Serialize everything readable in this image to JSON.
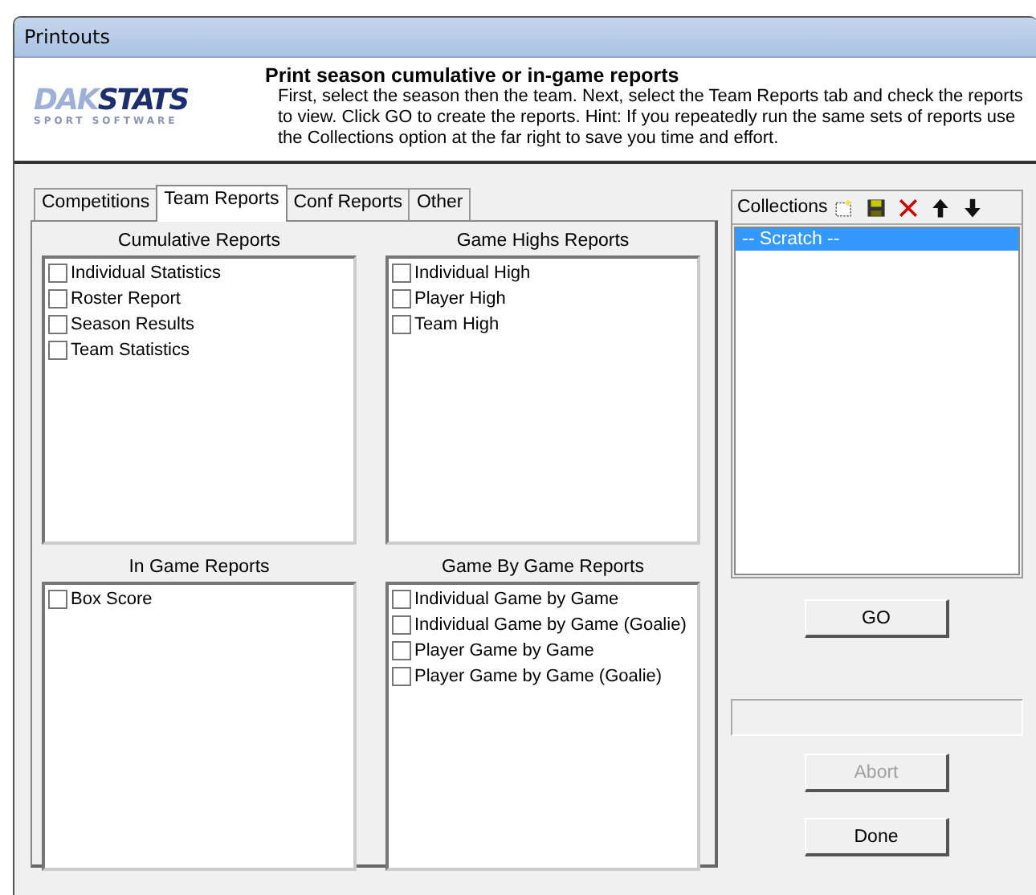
{
  "window": {
    "title": "Printouts"
  },
  "header": {
    "logo": {
      "main": "DAK",
      "accent": "STATS",
      "tagline": "SPORT SOFTWARE"
    },
    "heading": "Print season cumulative or in-game reports",
    "text": "First, select the season then the team.  Next, select the Team Reports tab and check the reports to view. Click GO to create the reports.  Hint: If you repeatedly run the same sets of reports use the Collections option at the far right to save you time and effort."
  },
  "tabs": [
    {
      "label": "Competitions",
      "selected": false
    },
    {
      "label": "Team Reports",
      "selected": true
    },
    {
      "label": "Conf Reports",
      "selected": false
    },
    {
      "label": "Other",
      "selected": false
    }
  ],
  "groups": [
    {
      "title": "Cumulative Reports",
      "items": [
        {
          "label": "Individual Statistics",
          "checked": false
        },
        {
          "label": "Roster Report",
          "checked": false
        },
        {
          "label": "Season Results",
          "checked": false
        },
        {
          "label": "Team Statistics",
          "checked": false
        }
      ]
    },
    {
      "title": "Game Highs Reports",
      "items": [
        {
          "label": "Individual High",
          "checked": false
        },
        {
          "label": "Player High",
          "checked": false
        },
        {
          "label": "Team High",
          "checked": false
        }
      ]
    },
    {
      "title": "In Game Reports",
      "items": [
        {
          "label": "Box Score",
          "checked": false
        }
      ]
    },
    {
      "title": "Game By Game Reports",
      "items": [
        {
          "label": "Individual Game by Game",
          "checked": false
        },
        {
          "label": "Individual Game by Game (Goalie)",
          "checked": false
        },
        {
          "label": "Player Game by Game",
          "checked": false
        },
        {
          "label": "Player Game by Game (Goalie)",
          "checked": false
        }
      ]
    }
  ],
  "collections": {
    "label": "Collections",
    "items": [
      {
        "label": "-- Scratch --",
        "selected": true
      }
    ]
  },
  "buttons": [
    {
      "label": "GO",
      "disabled": false
    },
    {
      "label": "Abort",
      "disabled": true
    },
    {
      "label": "Done",
      "disabled": false
    }
  ]
}
